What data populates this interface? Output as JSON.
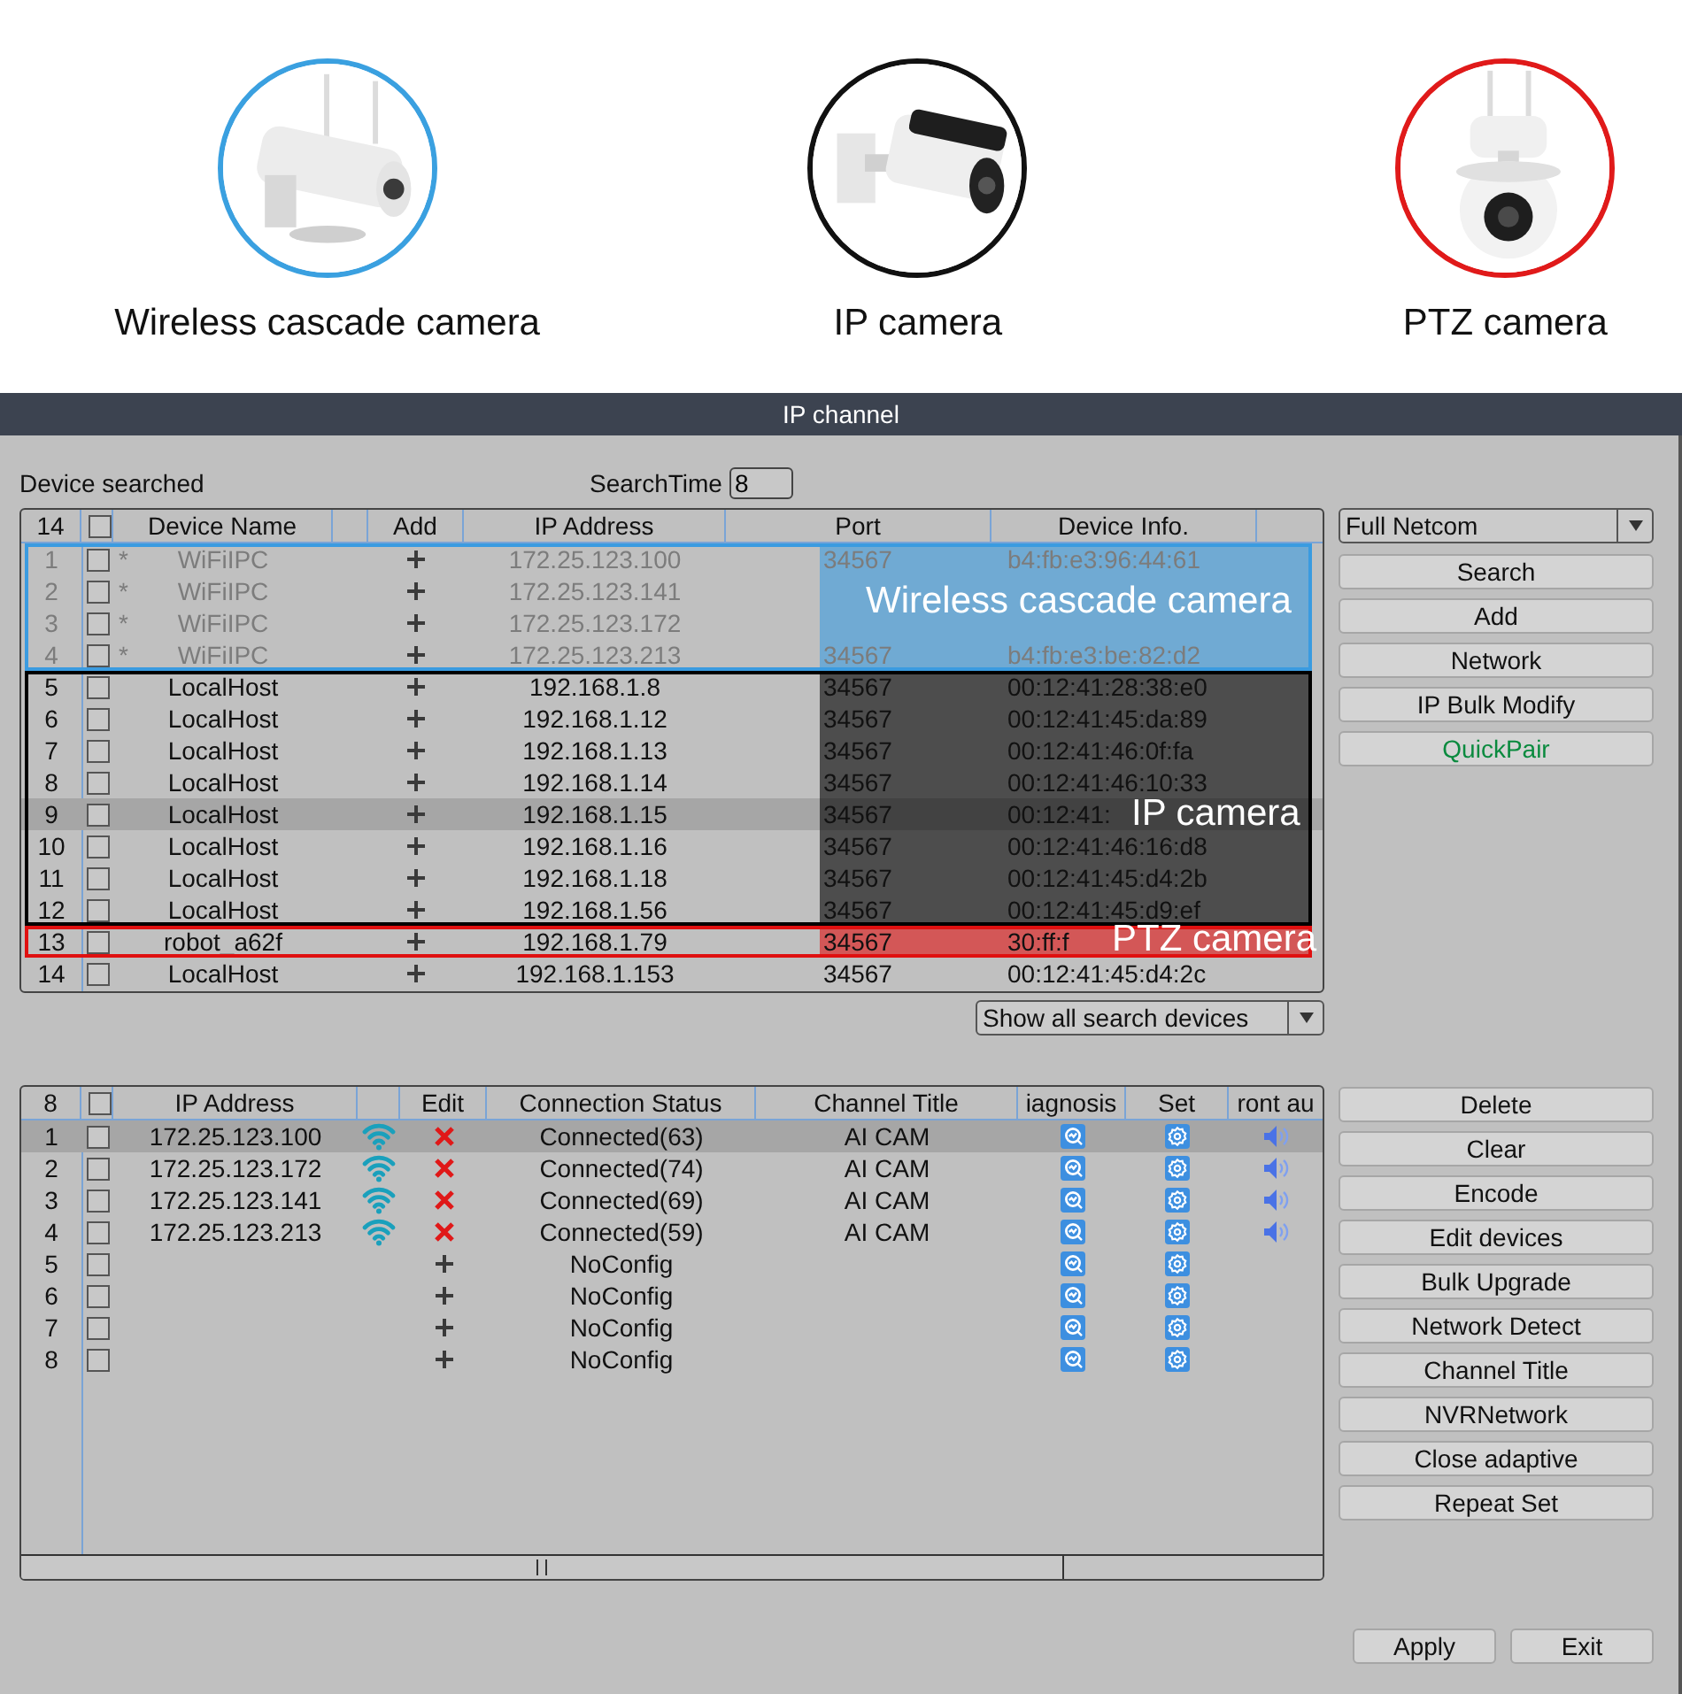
{
  "products": [
    {
      "caption": "Wireless cascade camera",
      "color": "#3aa0e0"
    },
    {
      "caption": "IP camera",
      "color": "#111111"
    },
    {
      "caption": "PTZ camera",
      "color": "#e01a1a"
    }
  ],
  "window": {
    "title": "IP channel"
  },
  "search": {
    "label": "Device searched",
    "time_label": "SearchTime",
    "time_value": "8"
  },
  "device_table": {
    "count": "14",
    "select_all_checked": false,
    "columns": [
      "Device Name",
      "Add",
      "IP Address",
      "Port",
      "Device Info."
    ],
    "groups": [
      {
        "color": "#3a9be0",
        "rows": [
          {
            "number": "1",
            "checked": false,
            "selected": false,
            "kind": "wifi",
            "mark": "*",
            "name": "WiFiIPC",
            "ip": "172.25.123.100",
            "port": "34567",
            "info": "b4:fb:e3:96:44:61"
          },
          {
            "number": "2",
            "checked": false,
            "selected": false,
            "kind": "wifi",
            "mark": "*",
            "name": "WiFiIPC",
            "ip": "172.25.123.141",
            "callout": "Wireless cascade camera"
          },
          {
            "number": "3",
            "checked": false,
            "selected": false,
            "kind": "wifi",
            "mark": "*",
            "name": "WiFiIPC",
            "ip": "172.25.123.172"
          },
          {
            "number": "4",
            "checked": false,
            "selected": false,
            "kind": "wifi",
            "mark": "*",
            "name": "WiFiIPC",
            "ip": "172.25.123.213",
            "port": "34567",
            "info": "b4:fb:e3:be:82:d2"
          }
        ]
      },
      {
        "color": "#000000",
        "rows": [
          {
            "number": "5",
            "checked": false,
            "selected": false,
            "kind": "lan",
            "name": "LocalHost",
            "ip": "192.168.1.8",
            "port": "34567",
            "info": "00:12:41:28:38:e0"
          },
          {
            "number": "6",
            "checked": false,
            "selected": false,
            "kind": "lan",
            "name": "LocalHost",
            "ip": "192.168.1.12",
            "port": "34567",
            "info": "00:12:41:45:da:89"
          },
          {
            "number": "7",
            "checked": false,
            "selected": false,
            "kind": "lan",
            "name": "LocalHost",
            "ip": "192.168.1.13",
            "port": "34567",
            "info": "00:12:41:46:0f:fa"
          },
          {
            "number": "8",
            "checked": false,
            "selected": false,
            "kind": "lan",
            "name": "LocalHost",
            "ip": "192.168.1.14",
            "port": "34567",
            "info": "00:12:41:46:10:33"
          },
          {
            "number": "9",
            "checked": false,
            "selected": true,
            "kind": "lan",
            "name": "LocalHost",
            "ip": "192.168.1.15",
            "port": "34567",
            "info": "00:12:41:",
            "callout": "IP camera"
          },
          {
            "number": "10",
            "checked": false,
            "selected": false,
            "kind": "lan",
            "name": "LocalHost",
            "ip": "192.168.1.16",
            "port": "34567",
            "info": "00:12:41:46:16:d8"
          },
          {
            "number": "11",
            "checked": false,
            "selected": false,
            "kind": "lan",
            "name": "LocalHost",
            "ip": "192.168.1.18",
            "port": "34567",
            "info": "00:12:41:45:d4:2b"
          },
          {
            "number": "12",
            "checked": false,
            "selected": false,
            "kind": "lan",
            "name": "LocalHost",
            "ip": "192.168.1.56",
            "port": "34567",
            "info": "00:12:41:45:d9:ef"
          }
        ]
      },
      {
        "color": "#e01010",
        "rows": [
          {
            "number": "13",
            "checked": false,
            "selected": false,
            "kind": "lan",
            "name": "robot_a62f",
            "ip": "192.168.1.79",
            "port": "34567",
            "info": "30:ff:f",
            "callout": "PTZ camera"
          }
        ]
      },
      {
        "rows": [
          {
            "number": "14",
            "checked": false,
            "selected": false,
            "kind": "lan",
            "name": "LocalHost",
            "ip": "192.168.1.153",
            "port": "34567",
            "info": "00:12:41:45:d4:2c"
          }
        ]
      }
    ]
  },
  "filter": {
    "value": "Show all search devices"
  },
  "protocol": {
    "value": "Full Netcom"
  },
  "search_buttons": [
    {
      "label": "Search",
      "kind": "normal"
    },
    {
      "label": "Add",
      "kind": "normal"
    },
    {
      "label": "Network",
      "kind": "normal"
    },
    {
      "label": "IP Bulk Modify",
      "kind": "normal"
    },
    {
      "label": "QuickPair",
      "kind": "accent"
    }
  ],
  "channel_table": {
    "count": "8",
    "select_all_checked": false,
    "columns": [
      "IP Address",
      "Edit",
      "Connection Status",
      "Channel Title",
      "iagnosis",
      "Set",
      "ront au"
    ],
    "rows": [
      {
        "number": "1",
        "checked": false,
        "selected": true,
        "ip": "172.25.123.100",
        "wireless": true,
        "deletable": true,
        "status": "Connected(63)",
        "title": "AI CAM",
        "audio": true
      },
      {
        "number": "2",
        "checked": false,
        "selected": false,
        "ip": "172.25.123.172",
        "wireless": true,
        "deletable": true,
        "status": "Connected(74)",
        "title": "AI CAM",
        "audio": true
      },
      {
        "number": "3",
        "checked": false,
        "selected": false,
        "ip": "172.25.123.141",
        "wireless": true,
        "deletable": true,
        "status": "Connected(69)",
        "title": "AI CAM",
        "audio": true
      },
      {
        "number": "4",
        "checked": false,
        "selected": false,
        "ip": "172.25.123.213",
        "wireless": true,
        "deletable": true,
        "status": "Connected(59)",
        "title": "AI CAM",
        "audio": true
      },
      {
        "number": "5",
        "checked": false,
        "selected": false,
        "wireless": false,
        "deletable": false,
        "status": "NoConfig",
        "audio": false
      },
      {
        "number": "6",
        "checked": false,
        "selected": false,
        "wireless": false,
        "deletable": false,
        "status": "NoConfig",
        "audio": false
      },
      {
        "number": "7",
        "checked": false,
        "selected": false,
        "wireless": false,
        "deletable": false,
        "status": "NoConfig",
        "audio": false
      },
      {
        "number": "8",
        "checked": false,
        "selected": false,
        "wireless": false,
        "deletable": false,
        "status": "NoConfig",
        "audio": false
      }
    ]
  },
  "channel_buttons": [
    "Delete",
    "Clear",
    "Encode",
    "Edit devices",
    "Bulk Upgrade",
    "Network Detect",
    "Channel Title",
    "NVRNetwork",
    "Close adaptive",
    "Repeat Set"
  ],
  "dialog_buttons": [
    "Apply",
    "Exit"
  ]
}
